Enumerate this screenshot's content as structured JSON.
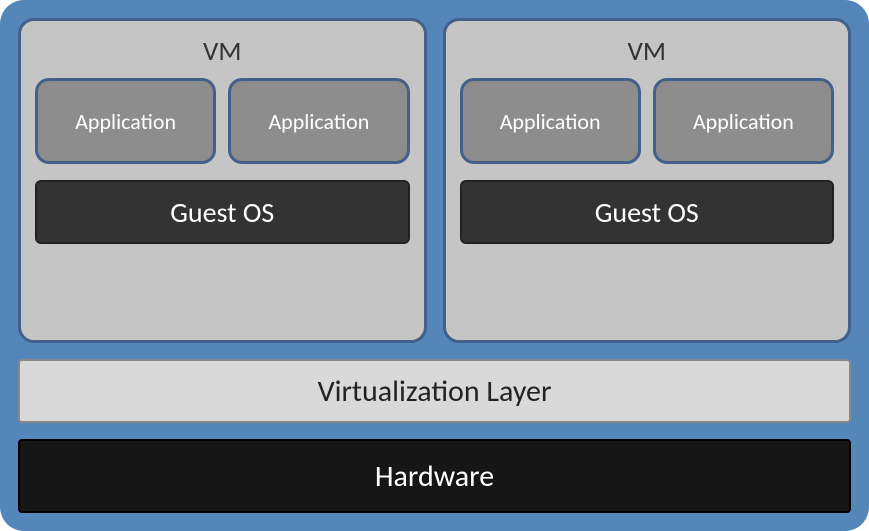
{
  "vms": [
    {
      "title": "VM",
      "apps": [
        "Application",
        "Application"
      ],
      "guest_os": "Guest OS"
    },
    {
      "title": "VM",
      "apps": [
        "Application",
        "Application"
      ],
      "guest_os": "Guest OS"
    }
  ],
  "virtualization_layer": "Virtualization Layer",
  "hardware": "Hardware"
}
